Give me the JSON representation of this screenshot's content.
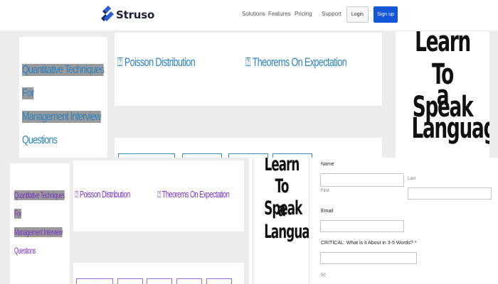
{
  "header": {
    "brand": "Struso",
    "nav": [
      "Solutions",
      "Features",
      "Pricing",
      "Support"
    ],
    "login_label": "Login",
    "signup_label": "Sign up"
  },
  "upper": {
    "sidebar_title": [
      "Quantitative Techniques For",
      "Management Interview",
      "Questions"
    ],
    "links": [
      "Poisson Distribution",
      "Theorems On Expectation"
    ],
    "ad_text": [
      "Learn To Speak",
      "a Language"
    ]
  },
  "lower": {
    "sidebar_title": [
      "Quantitative Techniques For",
      "Management Interview",
      "Questions"
    ],
    "links": [
      "Poisson Distribution",
      "Theorems On Expectation"
    ],
    "ad_text": [
      "Learn To Speak",
      "a Language"
    ]
  },
  "form": {
    "name_label": "Name",
    "first_label": "First",
    "last_label": "Last",
    "email_label": "Email",
    "critical_label": "CRITICAL: What is it About in 3-5 Words? *",
    "counter": "50"
  },
  "colors": {
    "brand_dark": "#1c1f3a",
    "primary_button": "#1356d8",
    "upper_link": "#2b83c1",
    "lower_link": "#7a32c4"
  }
}
